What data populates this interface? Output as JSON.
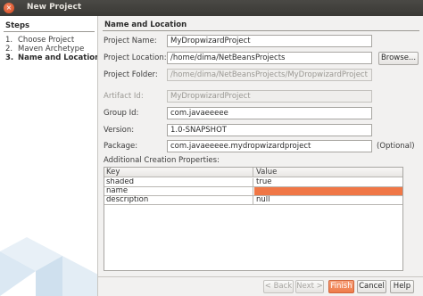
{
  "window": {
    "title": "New Project",
    "close_glyph": "×"
  },
  "steps": {
    "header": "Steps",
    "items": [
      {
        "num": "1.",
        "label": "Choose Project",
        "active": false
      },
      {
        "num": "2.",
        "label": "Maven Archetype",
        "active": false
      },
      {
        "num": "3.",
        "label": "Name and Location",
        "active": true
      }
    ]
  },
  "panel": {
    "title": "Name and Location"
  },
  "form": {
    "project_name": {
      "label": "Project Name:",
      "value": "MyDropwizardProject"
    },
    "project_location": {
      "label": "Project Location:",
      "value": "/home/dima/NetBeansProjects"
    },
    "browse": {
      "label": "Browse..."
    },
    "project_folder": {
      "label": "Project Folder:",
      "value": "/home/dima/NetBeansProjects/MyDropwizardProject"
    },
    "artifact_id": {
      "label": "Artifact Id:",
      "value": "MyDropwizardProject"
    },
    "group_id": {
      "label": "Group Id:",
      "value": "com.javaeeeee"
    },
    "version": {
      "label": "Version:",
      "value": "1.0-SNAPSHOT"
    },
    "package": {
      "label": "Package:",
      "value": "com.javaeeeee.mydropwizardproject",
      "hint": "(Optional)"
    }
  },
  "properties": {
    "label": "Additional Creation Properties:",
    "columns": [
      "Key",
      "Value"
    ],
    "rows": [
      {
        "key": "shaded",
        "value": "true"
      },
      {
        "key": "name",
        "value": ""
      },
      {
        "key": "description",
        "value": "null"
      }
    ]
  },
  "buttons": {
    "back": "< Back",
    "next": "Next >",
    "finish": "Finish",
    "cancel": "Cancel",
    "help": "Help"
  },
  "colors": {
    "accent": "#f07746",
    "titlebar": "#3c3b37"
  }
}
